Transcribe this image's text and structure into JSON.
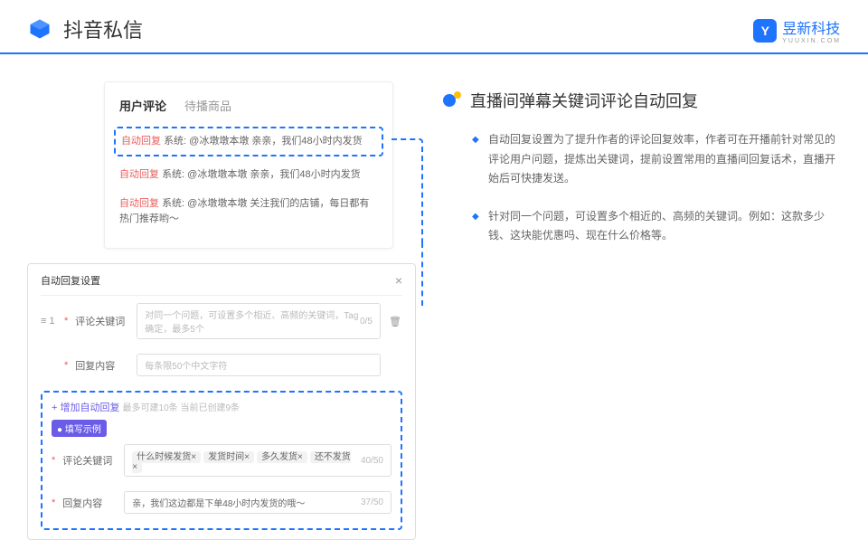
{
  "header": {
    "title": "抖音私信"
  },
  "brand": {
    "name": "昱新科技",
    "sub": "YUUXIN.COM",
    "icon": "Y"
  },
  "commentBox": {
    "tabs": [
      {
        "label": "用户评论",
        "active": true
      },
      {
        "label": "待播商品",
        "active": false
      }
    ],
    "items": [
      {
        "label": "自动回复",
        "text": "系统: @冰墩墩本墩 亲亲，我们48小时内发货"
      },
      {
        "label": "自动回复",
        "text": "系统: @冰墩墩本墩 亲亲，我们48小时内发货"
      },
      {
        "label": "自动回复",
        "text": "系统: @冰墩墩本墩 关注我们的店铺，每日都有热门推荐哟～"
      }
    ]
  },
  "settings": {
    "title": "自动回复设置",
    "rowNum": "1",
    "keywordLabel": "评论关键词",
    "keywordPlaceholder": "对同一个问题，可设置多个相近、高频的关键词，Tag确定，最多5个",
    "keywordCounter": "0/5",
    "contentLabel": "回复内容",
    "contentPlaceholder": "每条限50个中文字符",
    "addText": "+ 增加自动回复",
    "addHint": "最多可建10条 当前已创建9条",
    "exampleBadge": "● 填写示例",
    "example": {
      "keywordLabel": "评论关键词",
      "tags": [
        "什么时候发货×",
        "发货时间×",
        "多久发货×",
        "还不发货×"
      ],
      "keywordCounter": "40/50",
      "contentLabel": "回复内容",
      "contentText": "亲，我们这边都是下单48小时内发货的哦～",
      "contentCounter": "37/50"
    }
  },
  "right": {
    "title": "直播间弹幕关键词评论自动回复",
    "bullets": [
      "自动回复设置为了提升作者的评论回复效率，作者可在开播前针对常见的评论用户问题，提炼出关键词，提前设置常用的直播间回复话术，直播开始后可快捷发送。",
      "针对同一个问题，可设置多个相近的、高频的关键词。例如：这款多少钱、这块能优惠吗、现在什么价格等。"
    ]
  }
}
